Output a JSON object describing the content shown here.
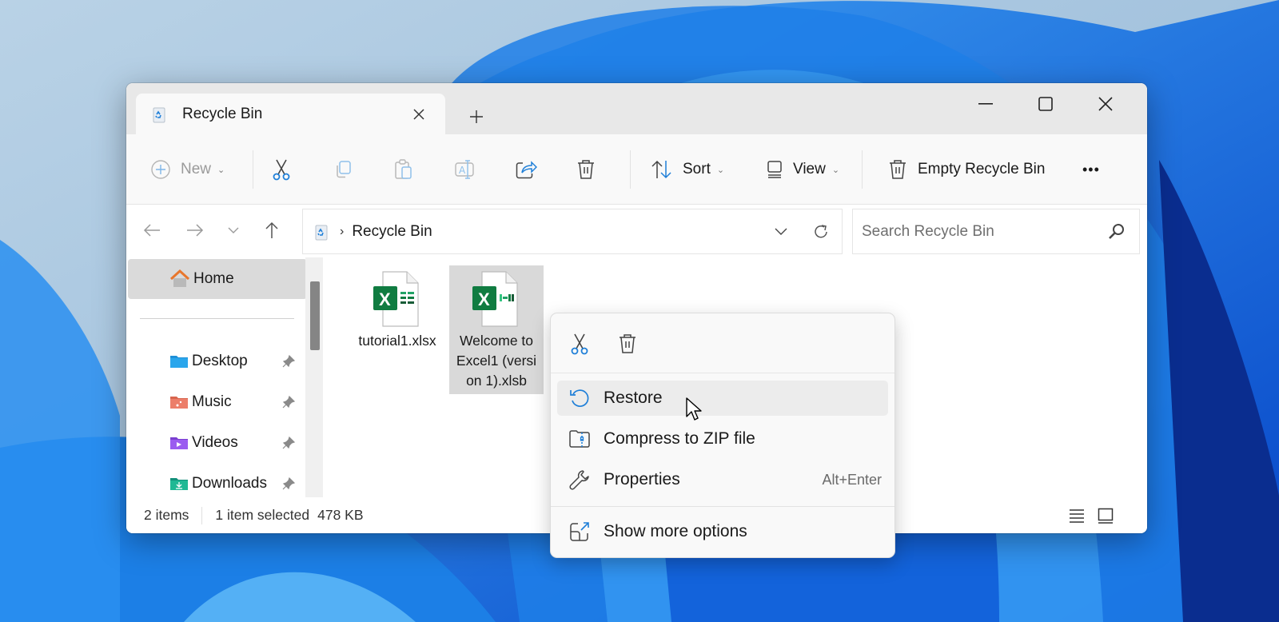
{
  "window": {
    "tab_title": "Recycle Bin",
    "new_tab_symbol": "+",
    "controls": {
      "minimize": "minimize",
      "maximize": "maximize",
      "close": "close"
    }
  },
  "toolbar": {
    "new_label": "New",
    "sort_label": "Sort",
    "view_label": "View",
    "empty_bin_label": "Empty Recycle Bin",
    "more_symbol": "•••",
    "chevron": "⌄",
    "icons": [
      "new-plus-icon",
      "cut-icon",
      "copy-icon",
      "paste-icon",
      "rename-icon",
      "share-icon",
      "delete-icon",
      "sort-icon",
      "view-icon",
      "empty-bin-icon",
      "more-icon"
    ]
  },
  "address": {
    "chevron_sep": "›",
    "crumb": "Recycle Bin",
    "search_placeholder": "Search Recycle Bin"
  },
  "sidebar": {
    "home_label": "Home",
    "items": [
      {
        "label": "Desktop",
        "color": "#1e90d8",
        "pinned": true
      },
      {
        "label": "Music",
        "color": "#e3745a",
        "pinned": true
      },
      {
        "label": "Videos",
        "color": "#8c4ee0",
        "pinned": true
      },
      {
        "label": "Downloads",
        "color": "#1aa880",
        "pinned": true
      }
    ]
  },
  "files": [
    {
      "name": "tutorial1.xlsx",
      "selected": false,
      "type": "xlsx"
    },
    {
      "name": "Welcome to Excel1 (version 1).xlsb",
      "selected": true,
      "type": "xlsb"
    }
  ],
  "status": {
    "count": "2 items",
    "selected": "1 item selected",
    "size": "478 KB"
  },
  "context_menu": {
    "top_icons": [
      "cut-icon",
      "delete-icon"
    ],
    "items": [
      {
        "label": "Restore",
        "shortcut": "",
        "hover": true
      },
      {
        "label": "Compress to ZIP file",
        "shortcut": ""
      },
      {
        "label": "Properties",
        "shortcut": "Alt+Enter"
      },
      {
        "label": "Show more options",
        "shortcut": ""
      }
    ]
  },
  "colors": {
    "accent": "#0f6cbd",
    "excel_green": "#107c41",
    "home_orange": "#e8762c"
  }
}
